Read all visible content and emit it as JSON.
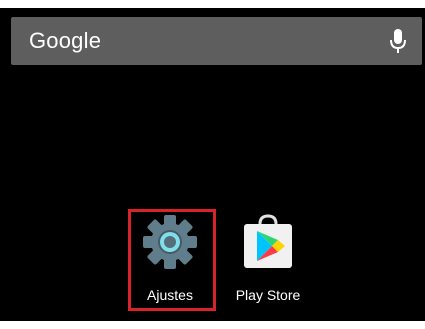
{
  "search_bar": {
    "logo_text": "Google",
    "mic_icon": "microphone-icon"
  },
  "apps": [
    {
      "label": "Ajustes",
      "icon": "settings-gear-icon",
      "highlighted": true
    },
    {
      "label": "Play Store",
      "icon": "play-store-icon",
      "highlighted": false
    }
  ],
  "colors": {
    "highlight": "#d9232a",
    "search_bar": "#5e5e5e",
    "wallpaper": "#000000"
  }
}
